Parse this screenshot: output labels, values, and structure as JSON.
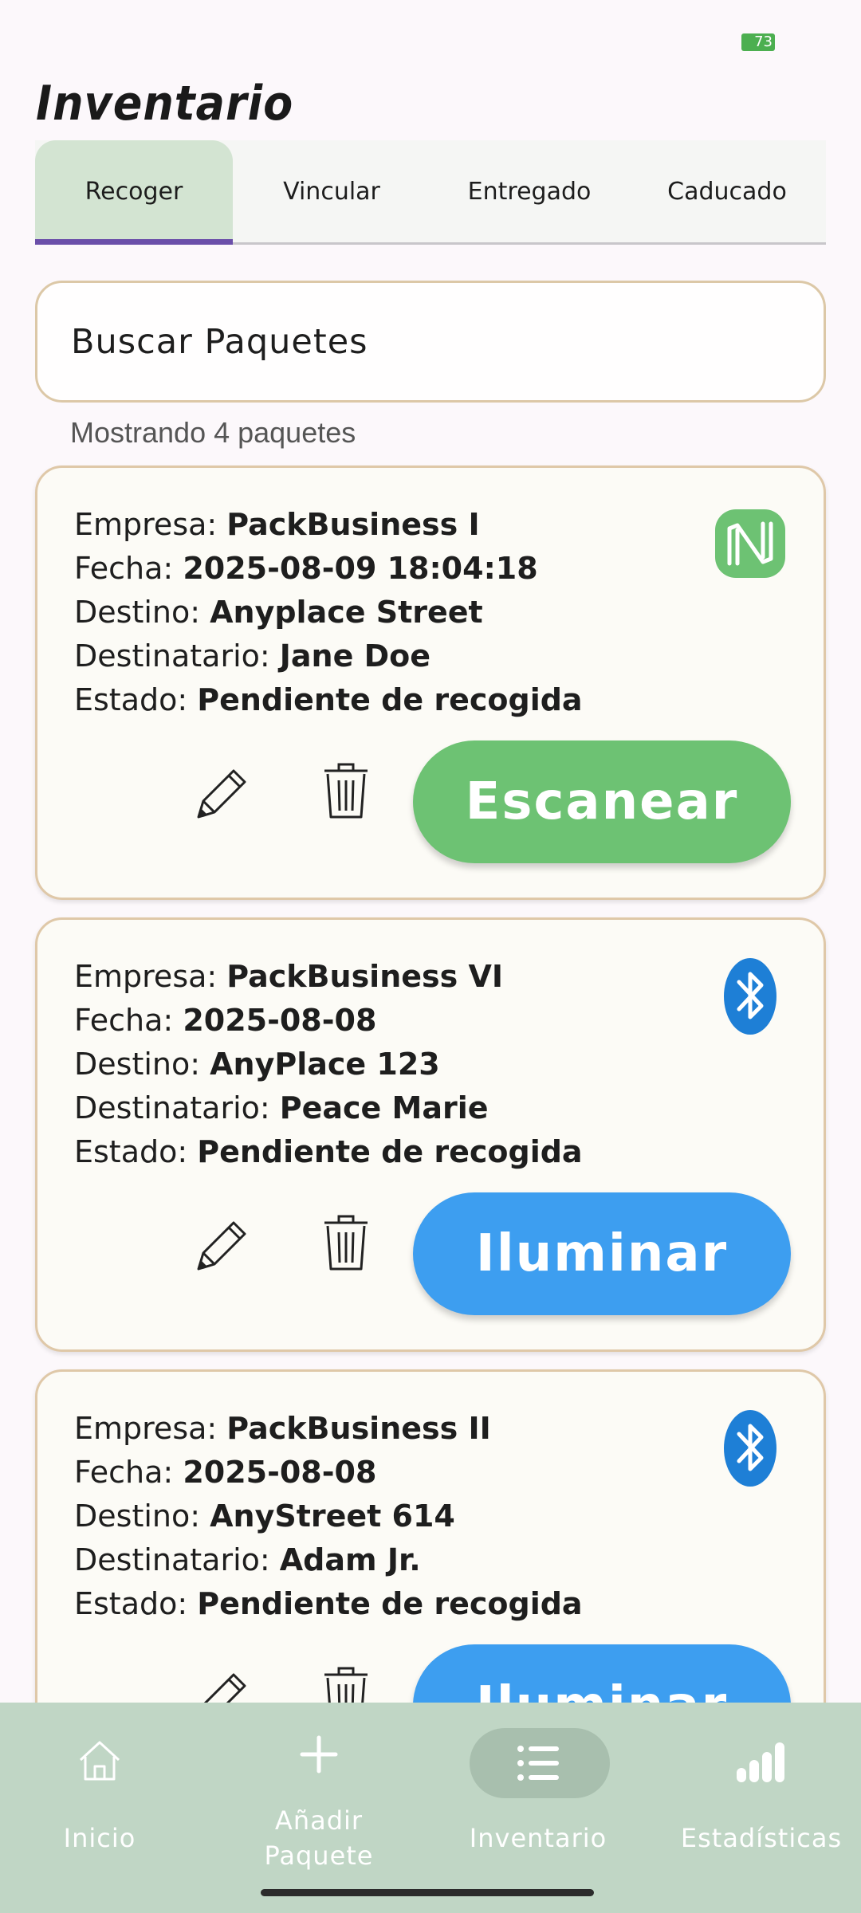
{
  "status_bar": {
    "battery": "73"
  },
  "page": {
    "title": "Inventario"
  },
  "tabs": [
    {
      "label": "Recoger",
      "active": true
    },
    {
      "label": "Vincular",
      "active": false
    },
    {
      "label": "Entregado",
      "active": false
    },
    {
      "label": "Caducado",
      "active": false
    }
  ],
  "search": {
    "placeholder": "Buscar Paquetes"
  },
  "results": {
    "count_text": "Mostrando 4 paquetes"
  },
  "labels": {
    "company": "Empresa: ",
    "date": "Fecha: ",
    "destination": "Destino: ",
    "recipient": "Destinatario: ",
    "status": "Estado: "
  },
  "packages": [
    {
      "company": "PackBusiness I",
      "date": "2025-08-09 18:04:18",
      "destination": "Anyplace Street",
      "recipient": "Jane Doe",
      "status": "Pendiente de recogida",
      "connection_icon": "nfc-icon",
      "action_label": "Escanear",
      "action_color": "#6dc273"
    },
    {
      "company": "PackBusiness VI",
      "date": "2025-08-08",
      "destination": "AnyPlace 123",
      "recipient": "Peace Marie",
      "status": "Pendiente de recogida",
      "connection_icon": "bluetooth-icon",
      "action_label": "Iluminar",
      "action_color": "#3d9ef0"
    },
    {
      "company": "PackBusiness II",
      "date": "2025-08-08",
      "destination": "AnyStreet 614",
      "recipient": "Adam Jr.",
      "status": "Pendiente de recogida",
      "connection_icon": "bluetooth-icon",
      "action_label": "Iluminar",
      "action_color": "#3d9ef0"
    }
  ],
  "bottom_nav": [
    {
      "label": "Inicio",
      "icon": "home-icon",
      "active": false
    },
    {
      "label": "Añadir Paquete",
      "line1": "Añadir",
      "line2": "Paquete",
      "icon": "plus-icon",
      "active": false
    },
    {
      "label": "Inventario",
      "icon": "list-icon",
      "active": true
    },
    {
      "label": "Estadísticas",
      "icon": "bar-chart-icon",
      "active": false
    }
  ],
  "colors": {
    "accent_tab_indicator": "#6b4fa9",
    "active_tab_bg": "#d3e4d2",
    "nav_bg": "#c0d6c5",
    "nfc_green": "#6dc273",
    "bluetooth_blue": "#1e7fd6"
  }
}
